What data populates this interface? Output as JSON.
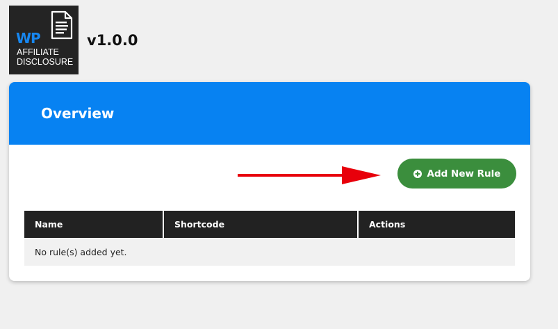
{
  "logo": {
    "brand": "WP",
    "line1": "AFFILIATE",
    "line2": "DISCLOSURE"
  },
  "version": "v1.0.0",
  "card": {
    "title": "Overview",
    "add_button_label": "Add New Rule"
  },
  "table": {
    "columns": [
      "Name",
      "Shortcode",
      "Actions"
    ],
    "empty_message": "No rule(s) added yet."
  },
  "colors": {
    "header_blue": "#0782f2",
    "button_green": "#3b8e3d",
    "arrow_red": "#e8000b",
    "table_header": "#222222",
    "logo_bg": "#242424"
  }
}
